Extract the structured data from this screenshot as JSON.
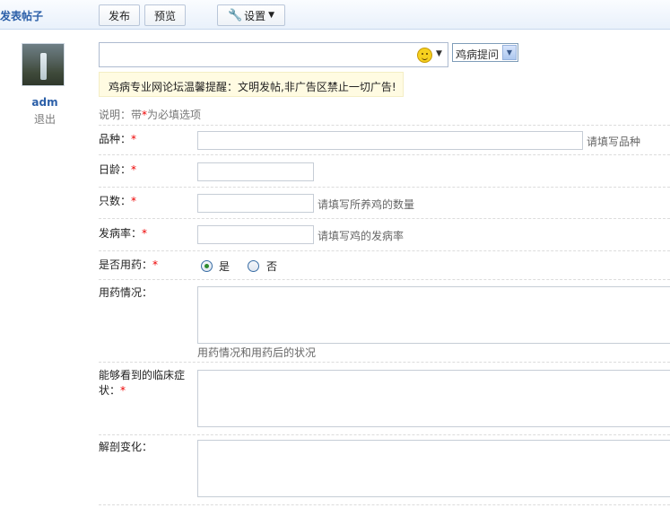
{
  "header": {
    "title": "发表帖子",
    "publish_label": "发布",
    "preview_label": "预览",
    "settings_label": "设置"
  },
  "user": {
    "name": "adm",
    "logout_label": "退出"
  },
  "subject": {
    "value": "",
    "placeholder": ""
  },
  "category": {
    "selected": "鸡病提问"
  },
  "notice": "鸡病专业网论坛温馨提醒：文明发帖,非广告区禁止一切广告!",
  "hint": {
    "prefix": "说明：带",
    "star": "*",
    "suffix": "为必填选项"
  },
  "fields": {
    "breed": {
      "label": "品种：",
      "required": "*",
      "hint": "请填写品种"
    },
    "age": {
      "label": "日龄：",
      "required": "*"
    },
    "count": {
      "label": "只数：",
      "required": "*",
      "hint": "请填写所养鸡的数量"
    },
    "rate": {
      "label": "发病率：",
      "required": "*",
      "hint": "请填写鸡的发病率"
    },
    "medication": {
      "label": "是否用药：",
      "required": "*",
      "yes": "是",
      "no": "否"
    },
    "med_status": {
      "label": "用药情况：",
      "hint": "用药情况和用药后的状况"
    },
    "symptoms": {
      "label": "能够看到的临床症状：",
      "required": "*"
    },
    "autopsy": {
      "label": "解剖变化："
    }
  },
  "colors": {
    "accent": "#2b5fa8",
    "required": "#e00000",
    "notice_bg": "#fffbe2"
  },
  "icons": {
    "settings": "wrench-icon",
    "emoticon": "smiley-icon"
  }
}
